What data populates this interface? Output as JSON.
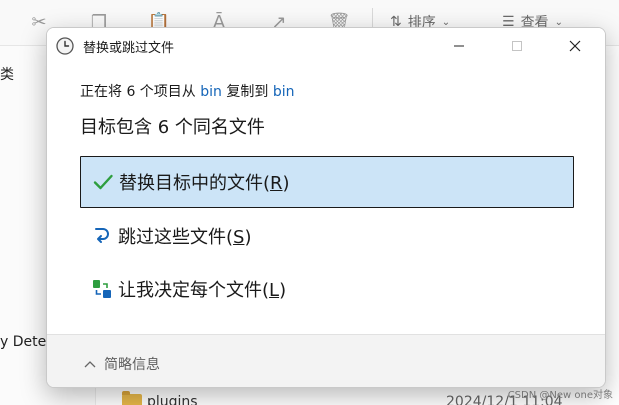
{
  "background": {
    "toolbar": {
      "sort_label": "排序",
      "view_label": "查看",
      "icons": [
        "scissors-icon",
        "copy-icon",
        "paste-icon",
        "rename-icon",
        "share-icon",
        "delete-icon"
      ]
    },
    "left_fragments": [
      "类",
      "y Detec"
    ],
    "row": {
      "name": "plugins",
      "date": "2024/12/1 11:04"
    },
    "watermark": "CSDN @New one对象"
  },
  "dialog": {
    "title": "替换或跳过文件",
    "controls": {
      "minimize": "minimize",
      "maximize": "maximize",
      "close": "close"
    },
    "subhead": {
      "prefix": "正在将 6 个项目从 ",
      "source": "bin",
      "middle": " 复制到 ",
      "dest": "bin"
    },
    "heading": "目标包含 6 个同名文件",
    "options": [
      {
        "label": "替换目标中的文件(",
        "key": "R",
        "suffix": ")",
        "icon": "checkmark-icon",
        "selected": true
      },
      {
        "label": "跳过这些文件(",
        "key": "S",
        "suffix": ")",
        "icon": "skip-arrow-icon",
        "selected": false
      },
      {
        "label": "让我决定每个文件(",
        "key": "L",
        "suffix": ")",
        "icon": "compare-files-icon",
        "selected": false
      }
    ],
    "footer": {
      "label": "简略信息",
      "icon": "chevron-up-icon"
    }
  },
  "colors": {
    "accent": "#1565b8",
    "selected_bg": "#cce4f7",
    "check_green": "#2e9e3f"
  }
}
